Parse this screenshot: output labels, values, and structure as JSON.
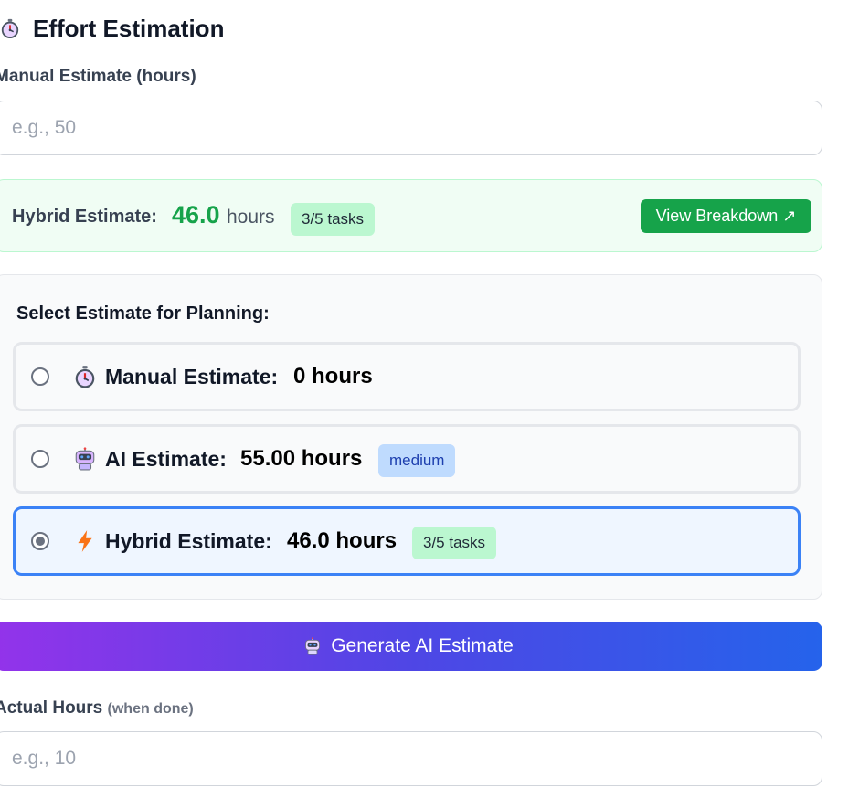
{
  "section": {
    "title": "Effort Estimation",
    "icon": "stopwatch-icon"
  },
  "manual_input": {
    "label": "Manual Estimate (hours)",
    "placeholder": "e.g., 50",
    "value": ""
  },
  "hybrid_banner": {
    "label": "Hybrid Estimate:",
    "value": "46.0",
    "unit": "hours",
    "badge": "3/5 tasks",
    "button": "View Breakdown ↗"
  },
  "planning": {
    "title": "Select Estimate for Planning:",
    "options": [
      {
        "icon": "stopwatch-icon",
        "label": "Manual Estimate:",
        "value": "0 hours",
        "badge": "",
        "selected": false
      },
      {
        "icon": "robot-icon",
        "label": "AI Estimate:",
        "value": "55.00 hours",
        "badge": "medium",
        "selected": false
      },
      {
        "icon": "lightning-icon",
        "label": "Hybrid Estimate:",
        "value": "46.0 hours",
        "badge": "3/5 tasks",
        "selected": true
      }
    ]
  },
  "generate_button": {
    "label": "Generate AI Estimate",
    "icon": "robot-icon"
  },
  "actual_input": {
    "label": "Actual Hours",
    "hint": "(when done)",
    "placeholder": "e.g., 10",
    "value": ""
  },
  "colors": {
    "success": "#16a34a",
    "selected_border": "#3b82f6",
    "gradient_start": "#9333ea",
    "gradient_end": "#2563eb"
  }
}
